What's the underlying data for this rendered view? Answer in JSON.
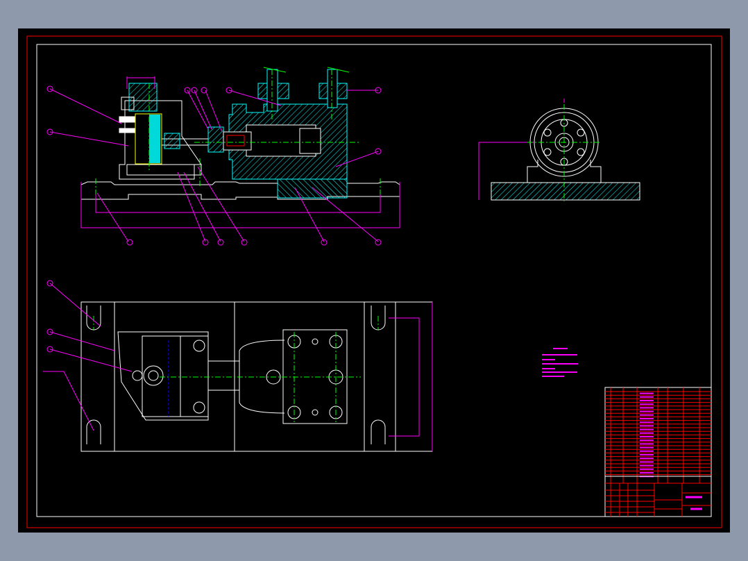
{
  "colors": {
    "background": "#8e9aab",
    "canvas": "#000000",
    "sheet_border": "#ff0000",
    "frame": "#ffffff",
    "outline": "#ffffff",
    "hatch": "#00ffff",
    "centerline": "#00ff00",
    "dimension": "#ff00ff",
    "hidden_line": "#0000ff",
    "highlight": "#ffff00",
    "title_block_grid": "#ff0000"
  },
  "views": [
    "front-section-view",
    "side-view",
    "top-view",
    "technical-requirements",
    "title-block"
  ]
}
